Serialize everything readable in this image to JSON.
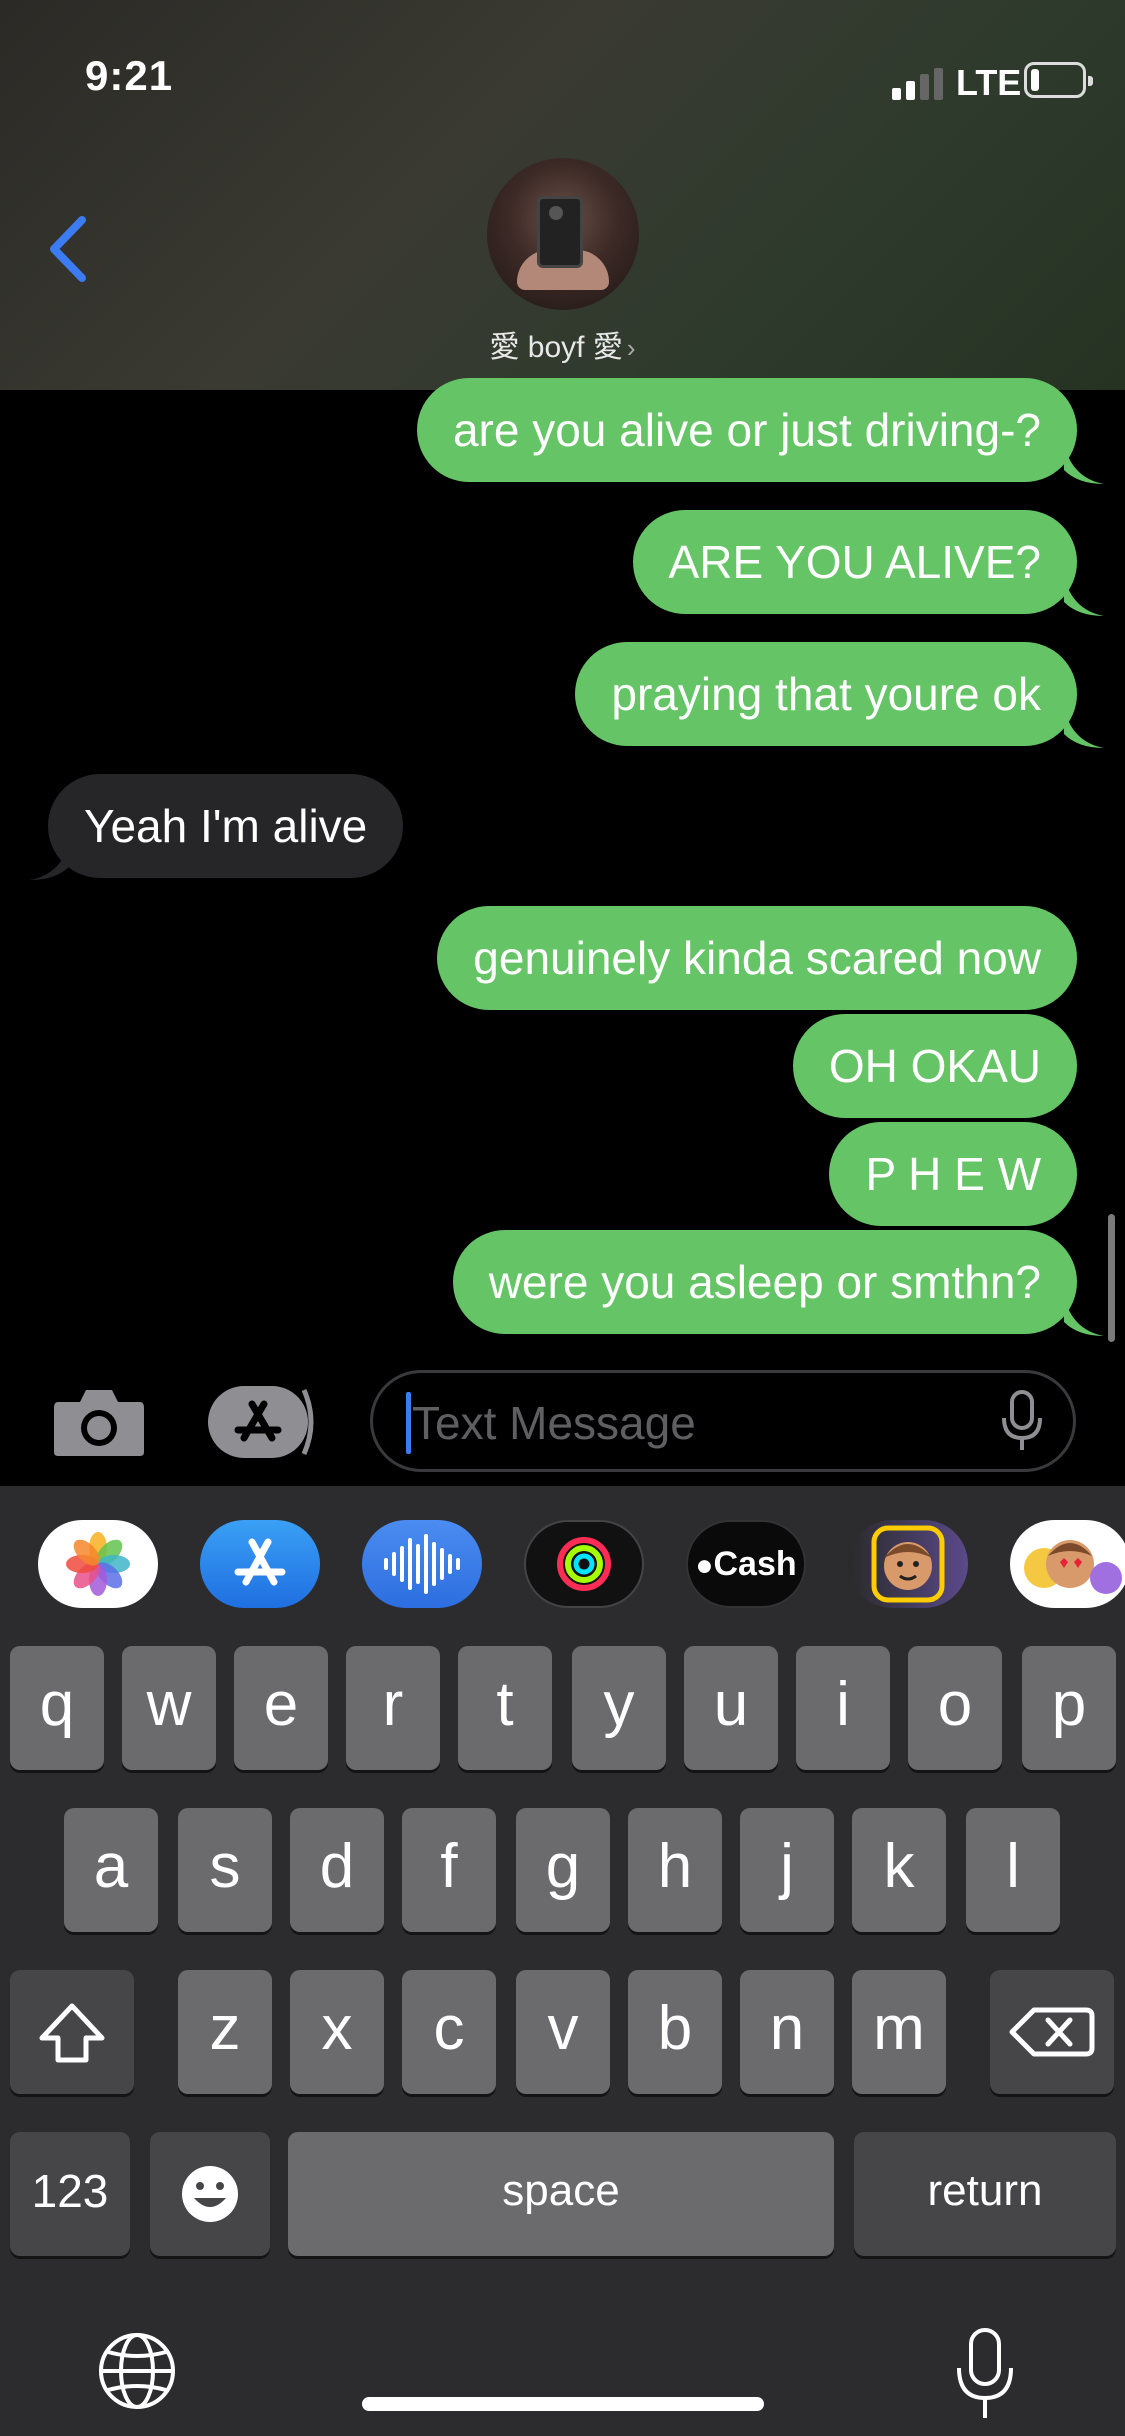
{
  "status_bar": {
    "time": "9:21",
    "network": "LTE"
  },
  "header": {
    "contact_name": "愛 boyf 愛",
    "chevron": "›"
  },
  "messages": [
    {
      "text": "are you alive or just driving-?",
      "from": "me"
    },
    {
      "text": "ARE YOU ALIVE?",
      "from": "me"
    },
    {
      "text": "praying that youre ok",
      "from": "me"
    },
    {
      "text": "Yeah I'm alive",
      "from": "them"
    },
    {
      "text": "genuinely kinda scared now",
      "from": "me"
    },
    {
      "text": "OH OKAU",
      "from": "me"
    },
    {
      "text": "P H E W",
      "from": "me"
    },
    {
      "text": "were you asleep or smthn?",
      "from": "me"
    }
  ],
  "input": {
    "placeholder": "Text Message"
  },
  "app_strip": {
    "items": [
      "photos-icon",
      "app-store-icon",
      "audio-message-icon",
      "activity-icon",
      "apple-cash-icon",
      "memoji-icon",
      "animoji-stickers-icon"
    ],
    "cash_label": "Cash"
  },
  "keyboard": {
    "row1": [
      "q",
      "w",
      "e",
      "r",
      "t",
      "y",
      "u",
      "i",
      "o",
      "p"
    ],
    "row2": [
      "a",
      "s",
      "d",
      "f",
      "g",
      "h",
      "j",
      "k",
      "l"
    ],
    "row3": [
      "z",
      "x",
      "c",
      "v",
      "b",
      "n",
      "m"
    ],
    "numbers_label": "123",
    "space_label": "space",
    "return_label": "return"
  },
  "colors": {
    "sent_bubble": "#65c466",
    "received_bubble": "#262628",
    "accent": "#3b7cf5",
    "keyboard_bg": "#2c2c2e"
  }
}
